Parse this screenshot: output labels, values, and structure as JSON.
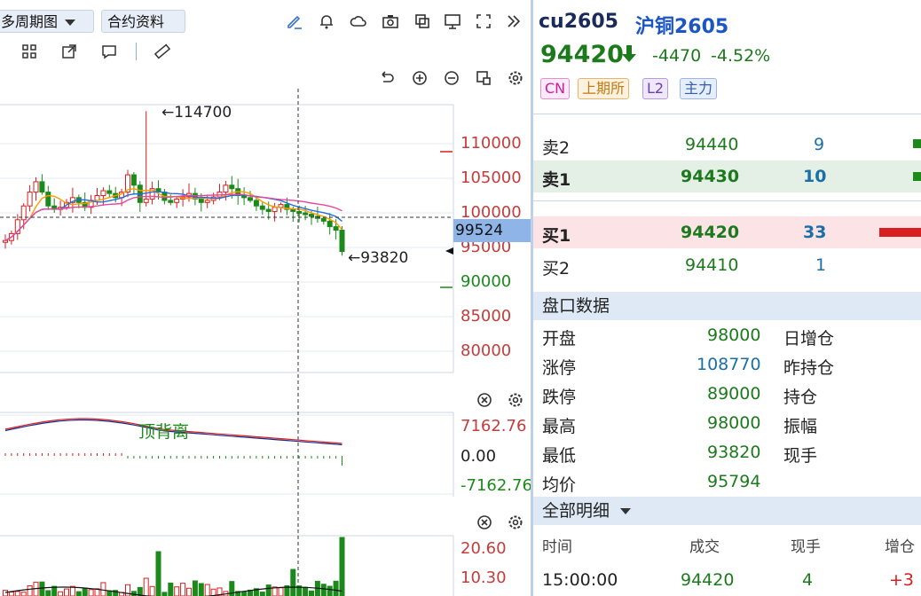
{
  "toolbar": {
    "period_label": "多周期图",
    "contract_info_label": "合约资料"
  },
  "chart": {
    "high_annotation": "←114700",
    "low_annotation": "←93820",
    "crosshair_price": "99524",
    "price_ticks": [
      "110000",
      "105000",
      "100000",
      "95000",
      "90000",
      "85000",
      "80000"
    ],
    "macd_text": "顶背离",
    "macd_ticks": [
      "7162.76",
      "0.00",
      "-7162.76"
    ],
    "vol_ticks": [
      "20.60",
      "10.30"
    ],
    "colors": {
      "up": "#d81e1e",
      "down": "#1b8a1b",
      "ma5": "#ff9a00",
      "ma10": "#1f6fe0",
      "ma20": "#e8489a"
    }
  },
  "quote": {
    "code": "cu2605",
    "name": "沪铜2605",
    "last": "94420",
    "change": "-4470",
    "change_pct": "-4.52%",
    "badges": [
      "CN",
      "上期所",
      "L2",
      "主力"
    ]
  },
  "orderbook": [
    {
      "label": "卖2",
      "price": "94440",
      "vol": "9"
    },
    {
      "label": "卖1",
      "price": "94430",
      "vol": "10"
    },
    {
      "label": "买1",
      "price": "94420",
      "vol": "33"
    },
    {
      "label": "买2",
      "price": "94410",
      "vol": "1"
    }
  ],
  "market_data": {
    "title": "盘口数据",
    "left": [
      {
        "label": "开盘",
        "value": "98000"
      },
      {
        "label": "涨停",
        "value": "108770"
      },
      {
        "label": "跌停",
        "value": "89000"
      },
      {
        "label": "最高",
        "value": "98000"
      },
      {
        "label": "最低",
        "value": "93820"
      },
      {
        "label": "均价",
        "value": "95794"
      }
    ],
    "right_labels": [
      "日增仓",
      "昨持仓",
      "持仓",
      "振幅",
      "现手"
    ]
  },
  "detail": {
    "title": "全部明细",
    "headers": [
      "时间",
      "成交",
      "现手",
      "增仓"
    ],
    "rows": [
      {
        "time": "15:00:00",
        "price": "94420",
        "vol": "4",
        "inc": "+3"
      }
    ]
  }
}
